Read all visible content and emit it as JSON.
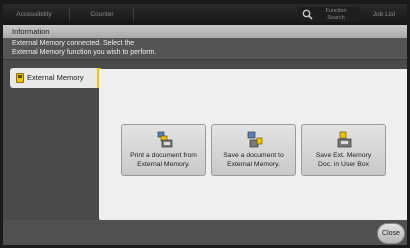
{
  "topbar": {
    "accessibility": "Accessibility",
    "counter": "Counter",
    "function_search_line1": "Function",
    "function_search_line2": "Search",
    "job_list": "Job List"
  },
  "info": {
    "title": "Information",
    "message_line1": "External Memory connected. Select the",
    "message_line2": "External Memory function you wish to perform."
  },
  "sidebar": {
    "tab_label": "External Memory"
  },
  "functions": [
    {
      "line1": "Print a document from",
      "line2": "External Memory.",
      "icon": "print-from-memory-icon"
    },
    {
      "line1": "Save a document to",
      "line2": "External Memory.",
      "icon": "save-to-memory-icon"
    },
    {
      "line1": "Save Ext. Memory",
      "line2": "Doc. in User Box",
      "icon": "save-to-user-box-icon"
    }
  ],
  "close_label": "Close",
  "colors": {
    "accent": "#f2c500",
    "panel": "#efefef",
    "background": "#4a4a4a"
  }
}
